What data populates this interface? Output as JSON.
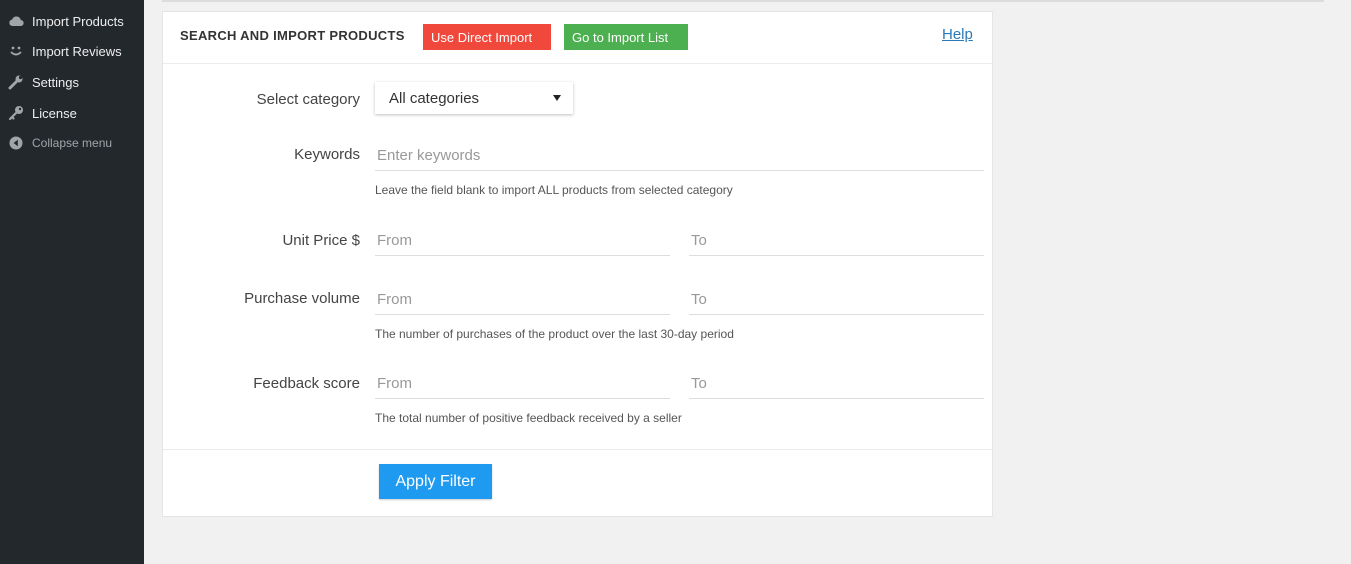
{
  "sidebar": {
    "items": [
      {
        "label": "Import Products",
        "icon": "cloud-icon"
      },
      {
        "label": "Import Reviews",
        "icon": "smiley-icon"
      },
      {
        "label": "Settings",
        "icon": "wrench-icon"
      },
      {
        "label": "License",
        "icon": "key-icon"
      },
      {
        "label": "Collapse menu",
        "icon": "collapse-arrow-icon"
      }
    ]
  },
  "panel": {
    "title": "SEARCH AND IMPORT PRODUCTS",
    "direct_import_label": "Use Direct Import",
    "import_list_label": "Go to Import List",
    "help_label": "Help"
  },
  "form": {
    "category": {
      "label": "Select category",
      "value": "All categories"
    },
    "keywords": {
      "label": "Keywords",
      "placeholder": "Enter keywords",
      "hint": "Leave the field blank to import ALL products from selected category"
    },
    "unit_price": {
      "label": "Unit Price $",
      "from_placeholder": "From",
      "to_placeholder": "To"
    },
    "purchase_volume": {
      "label": "Purchase volume",
      "from_placeholder": "From",
      "to_placeholder": "To",
      "hint": "The number of purchases of the product over the last 30-day period"
    },
    "feedback_score": {
      "label": "Feedback score",
      "from_placeholder": "From",
      "to_placeholder": "To",
      "hint": "The total number of positive feedback received by a seller"
    },
    "apply_label": "Apply Filter"
  },
  "colors": {
    "sidebar_bg": "#23282d",
    "direct_import": "#f1483c",
    "import_list": "#4caf50",
    "apply": "#1e9af0",
    "help_link": "#2a7ab8"
  }
}
